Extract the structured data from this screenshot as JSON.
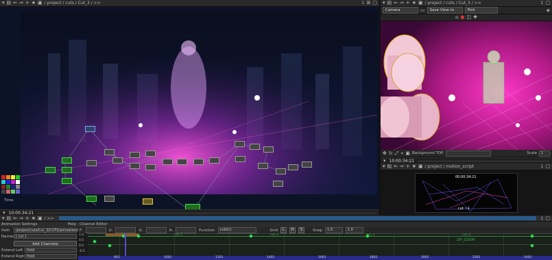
{
  "left_pane": {
    "toolbar": {
      "path": "/ project / cuts / Cut_3 / >>",
      "pane_id": "1",
      "frame_count": "1"
    },
    "bottom_label": "Time",
    "timecode_label": "10:00:34:21"
  },
  "right_pane": {
    "toolbar": {
      "path": "/ project / cuts / Cut_3 / >>",
      "pane_id": "1",
      "frame_count": "1"
    },
    "viewer": {
      "camera_select": "Camera",
      "save_view_select": "Save View to",
      "mode_select": "Pick",
      "background_label": "Background TOP",
      "scale_label": "Scale",
      "scale_value": "1",
      "timecode": "10:00:34:21"
    },
    "script_toolbar": {
      "path": "/ project / motion_script",
      "pane_id": "1"
    },
    "script_timecode": "00:00:34:21",
    "script_text": "cut ~1"
  },
  "bottom_pane": {
    "toolbar": {
      "pane_id": "1"
    },
    "animation_settings_label": "Animation Settings",
    "help_label": "Help",
    "channel_editor_label": "Channel Editor",
    "path_label": "Path",
    "path_value": "/project/cuts/Cut_3/CUTS/animation1",
    "names_label": "Names",
    "names_value": "[ cut ]",
    "add_channels_label": "Add Channels",
    "extend_left_label": "Extend Left",
    "extend_left_value": "Hold",
    "extend_right_label": "Extend Right",
    "extend_right_value": "Hold",
    "field_labels": {
      "f": "F:",
      "u": "U:",
      "g": "G:",
      "a": "A:"
    },
    "function_label": "Function",
    "function_value": "cubic()",
    "grid_label": "Grid",
    "snap_label": "Snap",
    "snap_value": "1.0",
    "snap_value2": "1.0",
    "value_ticks": [
      "1.0",
      "0.5",
      "0.0",
      "-0.5"
    ],
    "frame_ticks": [
      "901",
      "1001",
      "1201",
      "1401",
      "1601",
      "1801",
      "2001",
      "2201",
      "2401"
    ],
    "curve_tags": [
      "cut_1",
      "cut_2",
      "cut_3",
      "cut_4"
    ],
    "zoom_label": "ZIP_ZOOM"
  },
  "colors": {
    "keyframe": "#33dd55",
    "playhead": "#5a4ad6",
    "magenta": "#ff3cc8"
  }
}
